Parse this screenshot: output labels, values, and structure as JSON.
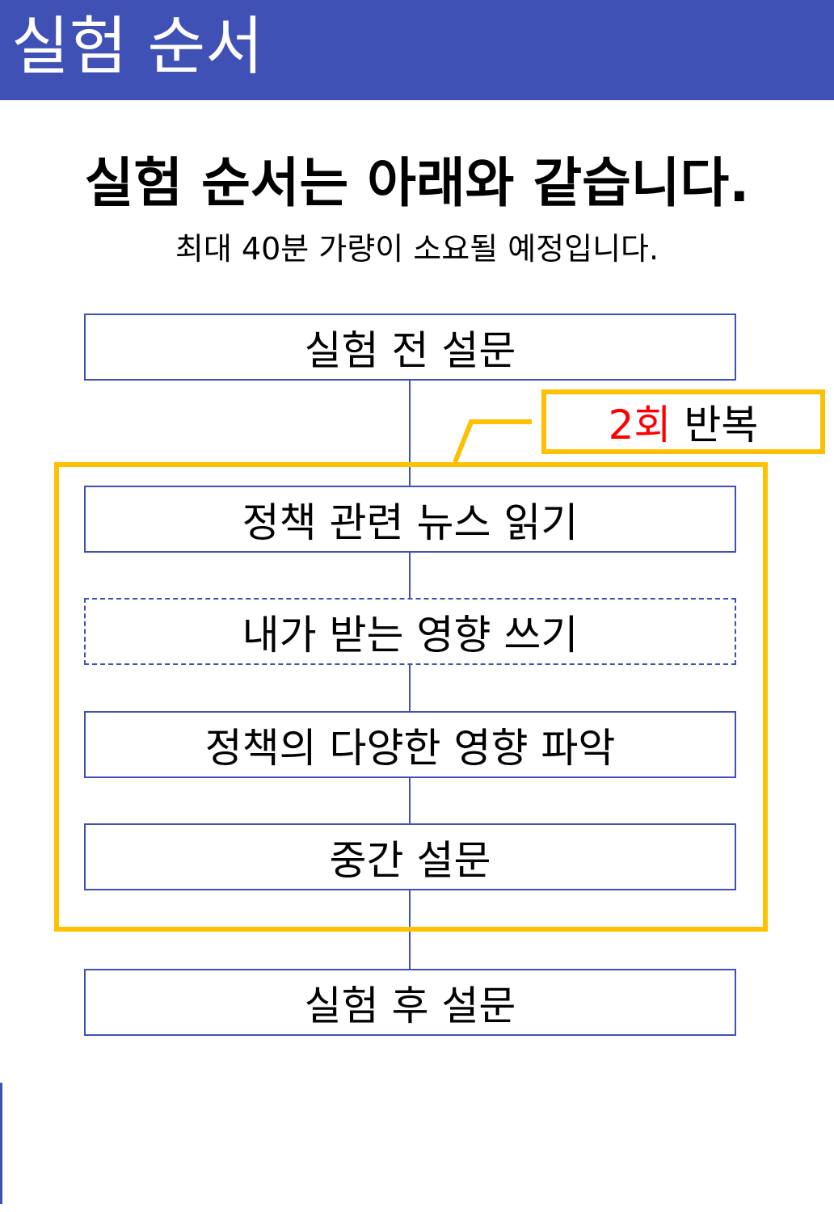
{
  "header": {
    "title": "실험 순서"
  },
  "headline": "실험 순서는 아래와 같습니다.",
  "subline": "최대 40분 가량이 소요될 예정입니다.",
  "steps": [
    {
      "label": "실험 전 설문"
    },
    {
      "label": "정책 관련 뉴스 읽기"
    },
    {
      "label": "내가 받는 영향 쓰기"
    },
    {
      "label": "정책의 다양한 영향 파악"
    },
    {
      "label": "중간 설문"
    },
    {
      "label": "실험 후 설문"
    }
  ],
  "repeat": {
    "count": "2회",
    "label": "반복"
  },
  "colors": {
    "header": "#3f51b5",
    "box_border": "#3f51b5",
    "repeat": "#ffc000",
    "count": "#ff0000"
  }
}
